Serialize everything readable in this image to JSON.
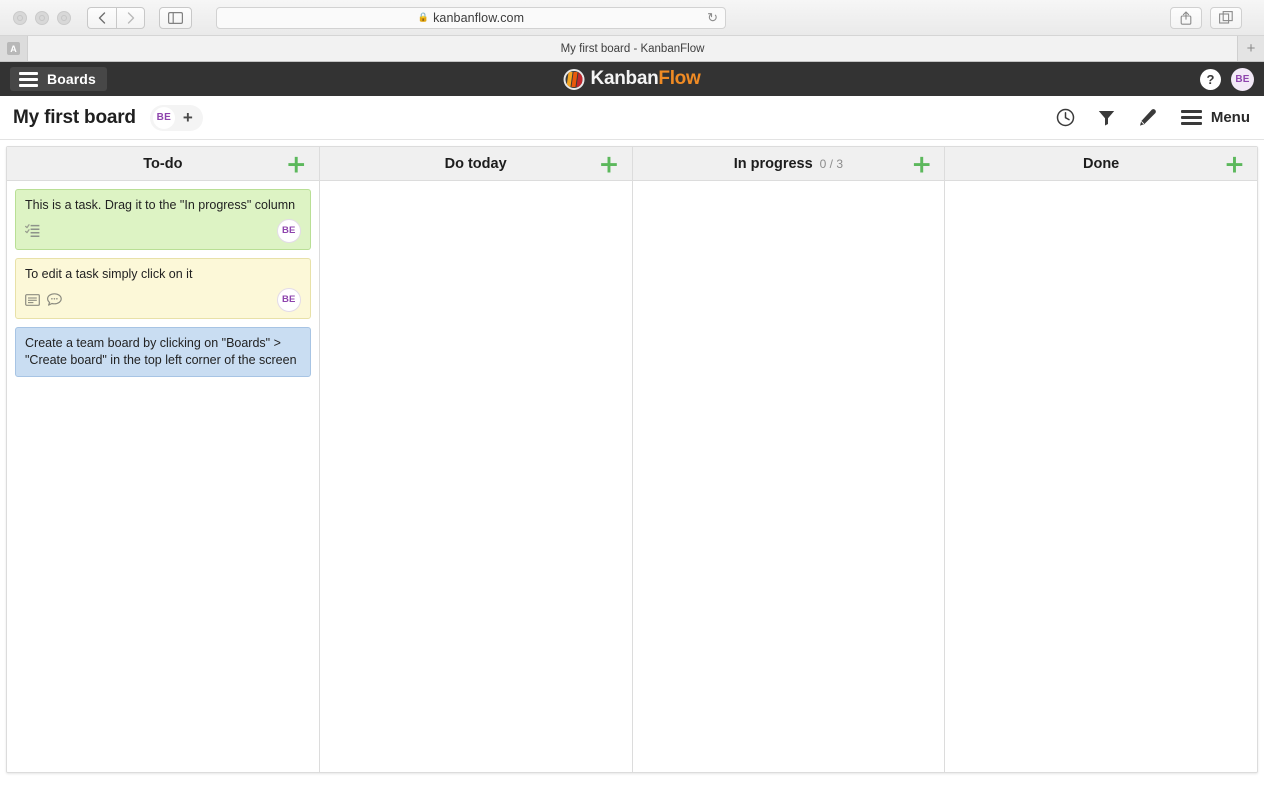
{
  "browser": {
    "url": "kanbanflow.com",
    "lock_icon": "lock-icon",
    "reload_icon": "reload-icon",
    "back_icon": "chevron-left-icon",
    "forward_icon": "chevron-right-icon",
    "sidebar_icon": "sidebar-toggle-icon",
    "share_icon": "share-icon",
    "tabs_icon": "show-tabs-icon",
    "tab_title": "My first board - KanbanFlow",
    "favicon_letter": "A",
    "new_tab_icon": "+"
  },
  "app_header": {
    "boards_label": "Boards",
    "brand_first": "Kanban",
    "brand_second": "Flow",
    "help_label": "?",
    "avatar_initials": "BE"
  },
  "title_bar": {
    "board_name": "My first board",
    "member_initials": "BE",
    "add_member_label": "+",
    "icons": [
      {
        "name": "clock-icon"
      },
      {
        "name": "filter-icon"
      },
      {
        "name": "pencil-icon"
      }
    ],
    "menu_label": "Menu"
  },
  "board": {
    "columns": [
      {
        "title": "To-do",
        "limit": "",
        "add_label": "+",
        "cards": [
          {
            "text": "This is a task. Drag it to the \"In progress\" column",
            "color": "card-green",
            "icons": [
              "checklist-icon"
            ],
            "avatar": "BE"
          },
          {
            "text": "To edit a task simply click on it",
            "color": "card-yellow",
            "icons": [
              "description-icon",
              "comment-icon"
            ],
            "avatar": "BE"
          },
          {
            "text": "Create a team board by clicking on \"Boards\" > \"Create board\" in the top left corner of the screen",
            "color": "card-blue",
            "icons": [],
            "avatar": ""
          }
        ]
      },
      {
        "title": "Do today",
        "limit": "",
        "add_label": "+",
        "cards": []
      },
      {
        "title": "In progress",
        "limit": "0 / 3",
        "add_label": "+",
        "cards": []
      },
      {
        "title": "Done",
        "limit": "",
        "add_label": "+",
        "cards": []
      }
    ]
  },
  "colors": {
    "accent_green": "#5cb85c",
    "brand_orange": "#f08b24",
    "header_dark": "#333333",
    "avatar_purple": "#8e44ad"
  }
}
